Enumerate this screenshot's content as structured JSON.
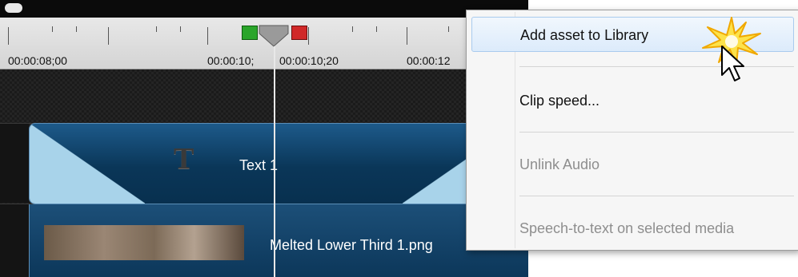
{
  "timeline": {
    "ruler_labels": [
      "00:00:08;00",
      "00:00:10;",
      "00:00:10;20",
      "00:00:12"
    ],
    "tracks": [
      {
        "clip_label": "Text 1",
        "icon": "text-T-icon"
      },
      {
        "clip_label": "Melted Lower Third 1.png",
        "icon": "image-thumbnail"
      }
    ],
    "colors": {
      "clip_blue": "#0a3658",
      "mark_in": "#2aa52a",
      "mark_out": "#d02828"
    }
  },
  "context_menu": {
    "items": [
      {
        "label": "Add asset to Library",
        "enabled": true,
        "highlighted": true
      },
      {
        "label": "Clip speed...",
        "enabled": true,
        "highlighted": false
      },
      {
        "label": "Unlink Audio",
        "enabled": false,
        "highlighted": false
      },
      {
        "label": "Speech-to-text on selected media",
        "enabled": false,
        "highlighted": false
      }
    ]
  }
}
